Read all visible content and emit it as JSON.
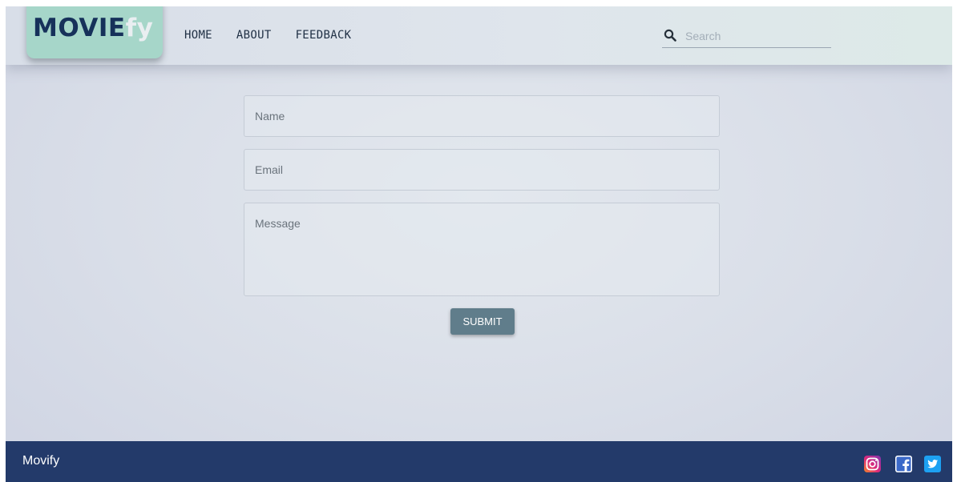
{
  "header": {
    "logo": {
      "main": "MOVIE",
      "accent": "fy"
    },
    "nav": [
      {
        "label": "HOME"
      },
      {
        "label": "ABOUT"
      },
      {
        "label": "FEEDBACK"
      }
    ],
    "search": {
      "placeholder": "Search",
      "icon": "search-icon"
    }
  },
  "form": {
    "name_placeholder": "Name",
    "email_placeholder": "Email",
    "message_placeholder": "Message",
    "submit_label": "SUBMIT"
  },
  "footer": {
    "brand": "Movify",
    "social": [
      {
        "icon": "instagram-icon"
      },
      {
        "icon": "facebook-icon"
      },
      {
        "icon": "twitter-icon"
      }
    ]
  },
  "colors": {
    "footer_bg": "#233a6a",
    "logo_bg": "#a6d6c9",
    "logo_text": "#16315a",
    "submit_bg": "#607d8b"
  }
}
